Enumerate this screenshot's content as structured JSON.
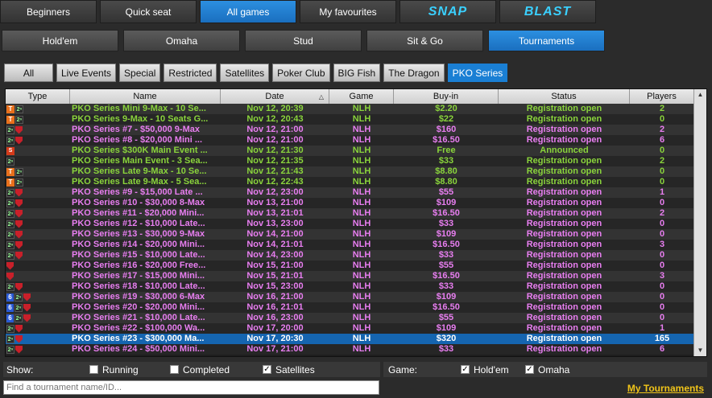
{
  "top_tabs": [
    {
      "label": "Beginners",
      "active": false
    },
    {
      "label": "Quick seat",
      "active": false
    },
    {
      "label": "All games",
      "active": true
    },
    {
      "label": "My favourites",
      "active": false
    },
    {
      "label": "SNAP",
      "active": false,
      "logo": true
    },
    {
      "label": "BLAST",
      "active": false,
      "logo": true
    }
  ],
  "sub_tabs": [
    {
      "label": "Hold'em",
      "active": false
    },
    {
      "label": "Omaha",
      "active": false
    },
    {
      "label": "Stud",
      "active": false
    },
    {
      "label": "Sit & Go",
      "active": false
    },
    {
      "label": "Tournaments",
      "active": true
    }
  ],
  "filters": [
    {
      "label": "All",
      "active": false
    },
    {
      "label": "Live Events",
      "active": false
    },
    {
      "label": "Special",
      "active": false
    },
    {
      "label": "Restricted",
      "active": false
    },
    {
      "label": "Satellites",
      "active": false
    },
    {
      "label": "Poker Club",
      "active": false
    },
    {
      "label": "BIG Fish",
      "active": false
    },
    {
      "label": "The Dragon",
      "active": false
    },
    {
      "label": "PKO Series",
      "active": true
    }
  ],
  "columns": {
    "type": "Type",
    "name": "Name",
    "date": "Date",
    "game": "Game",
    "buyin": "Buy-in",
    "status": "Status",
    "players": "Players"
  },
  "rows": [
    {
      "icons": [
        "T",
        "2"
      ],
      "name": "PKO Series Mini 9-Max - 10 Se...",
      "date": "Nov 12, 20:39",
      "game": "NLH",
      "buyin": "$2.20",
      "status": "Registration open",
      "players": "2",
      "color": "green"
    },
    {
      "icons": [
        "T",
        "2"
      ],
      "name": "PKO Series 9-Max - 10 Seats G...",
      "date": "Nov 12, 20:43",
      "game": "NLH",
      "buyin": "$22",
      "status": "Registration open",
      "players": "0",
      "color": "green"
    },
    {
      "icons": [
        "2",
        "sh"
      ],
      "name": "PKO Series #7 - $50,000 9-Max",
      "date": "Nov 12, 21:00",
      "game": "NLH",
      "buyin": "$160",
      "status": "Registration open",
      "players": "2",
      "color": "pink"
    },
    {
      "icons": [
        "2",
        "sh"
      ],
      "name": "PKO Series #8 - $20,000 Mini ...",
      "date": "Nov 12, 21:00",
      "game": "NLH",
      "buyin": "$16.50",
      "status": "Registration open",
      "players": "6",
      "color": "pink"
    },
    {
      "icons": [
        "si"
      ],
      "name": "PKO Series $300K Main Event ...",
      "date": "Nov 12, 21:30",
      "game": "NLH",
      "buyin": "Free",
      "status": "Announced",
      "players": "0",
      "color": "green"
    },
    {
      "icons": [
        "2"
      ],
      "name": "PKO Series Main Event - 3 Sea...",
      "date": "Nov 12, 21:35",
      "game": "NLH",
      "buyin": "$33",
      "status": "Registration open",
      "players": "2",
      "color": "green"
    },
    {
      "icons": [
        "T",
        "2"
      ],
      "name": "PKO Series Late 9-Max - 10 Se...",
      "date": "Nov 12, 21:43",
      "game": "NLH",
      "buyin": "$8.80",
      "status": "Registration open",
      "players": "0",
      "color": "green"
    },
    {
      "icons": [
        "T",
        "2"
      ],
      "name": "PKO Series Late 9-Max - 5 Sea...",
      "date": "Nov 12, 22:43",
      "game": "NLH",
      "buyin": "$8.80",
      "status": "Registration open",
      "players": "0",
      "color": "green"
    },
    {
      "icons": [
        "2",
        "sh"
      ],
      "name": "PKO Series #9 - $15,000 Late ...",
      "date": "Nov 12, 23:00",
      "game": "NLH",
      "buyin": "$55",
      "status": "Registration open",
      "players": "1",
      "color": "pink"
    },
    {
      "icons": [
        "2",
        "sh"
      ],
      "name": "PKO Series #10 - $30,000 8-Max",
      "date": "Nov 13, 21:00",
      "game": "NLH",
      "buyin": "$109",
      "status": "Registration open",
      "players": "0",
      "color": "pink"
    },
    {
      "icons": [
        "2",
        "sh"
      ],
      "name": "PKO Series #11 - $20,000 Mini...",
      "date": "Nov 13, 21:01",
      "game": "NLH",
      "buyin": "$16.50",
      "status": "Registration open",
      "players": "2",
      "color": "pink"
    },
    {
      "icons": [
        "2",
        "sh"
      ],
      "name": "PKO Series #12 - $10,000 Late...",
      "date": "Nov 13, 23:00",
      "game": "NLH",
      "buyin": "$33",
      "status": "Registration open",
      "players": "0",
      "color": "pink"
    },
    {
      "icons": [
        "2",
        "sh"
      ],
      "name": "PKO Series #13 - $30,000 9-Max",
      "date": "Nov 14, 21:00",
      "game": "NLH",
      "buyin": "$109",
      "status": "Registration open",
      "players": "0",
      "color": "pink"
    },
    {
      "icons": [
        "2",
        "sh"
      ],
      "name": "PKO Series #14 - $20,000 Mini...",
      "date": "Nov 14, 21:01",
      "game": "NLH",
      "buyin": "$16.50",
      "status": "Registration open",
      "players": "3",
      "color": "pink"
    },
    {
      "icons": [
        "2",
        "sh"
      ],
      "name": "PKO Series #15 - $10,000 Late...",
      "date": "Nov 14, 23:00",
      "game": "NLH",
      "buyin": "$33",
      "status": "Registration open",
      "players": "0",
      "color": "pink"
    },
    {
      "icons": [
        "sh"
      ],
      "name": "PKO Series #16 - $20,000 Free...",
      "date": "Nov 15, 21:00",
      "game": "NLH",
      "buyin": "$55",
      "status": "Registration open",
      "players": "0",
      "color": "pink"
    },
    {
      "icons": [
        "sh"
      ],
      "name": "PKO Series #17 - $15,000 Mini...",
      "date": "Nov 15, 21:01",
      "game": "NLH",
      "buyin": "$16.50",
      "status": "Registration open",
      "players": "3",
      "color": "pink"
    },
    {
      "icons": [
        "2",
        "sh"
      ],
      "name": "PKO Series #18 - $10,000 Late...",
      "date": "Nov 15, 23:00",
      "game": "NLH",
      "buyin": "$33",
      "status": "Registration open",
      "players": "0",
      "color": "pink"
    },
    {
      "icons": [
        "6",
        "2",
        "sh"
      ],
      "name": "PKO Series #19 - $30,000 6-Max",
      "date": "Nov 16, 21:00",
      "game": "NLH",
      "buyin": "$109",
      "status": "Registration open",
      "players": "0",
      "color": "pink"
    },
    {
      "icons": [
        "6",
        "2",
        "sh"
      ],
      "name": "PKO Series #20 - $20,000 Mini...",
      "date": "Nov 16, 21:01",
      "game": "NLH",
      "buyin": "$16.50",
      "status": "Registration open",
      "players": "0",
      "color": "pink"
    },
    {
      "icons": [
        "6",
        "2",
        "sh"
      ],
      "name": "PKO Series #21 - $10,000 Late...",
      "date": "Nov 16, 23:00",
      "game": "NLH",
      "buyin": "$55",
      "status": "Registration open",
      "players": "0",
      "color": "pink"
    },
    {
      "icons": [
        "2",
        "sh"
      ],
      "name": "PKO Series #22 - $100,000 Wa...",
      "date": "Nov 17, 20:00",
      "game": "NLH",
      "buyin": "$109",
      "status": "Registration open",
      "players": "1",
      "color": "pink"
    },
    {
      "icons": [
        "2",
        "sh"
      ],
      "name": "PKO Series #23 - $300,000 Ma...",
      "date": "Nov 17, 20:30",
      "game": "NLH",
      "buyin": "$320",
      "status": "Registration open",
      "players": "165",
      "color": "pink",
      "selected": true
    },
    {
      "icons": [
        "2",
        "sh"
      ],
      "name": "PKO Series #24 - $50,000 Mini...",
      "date": "Nov 17, 21:00",
      "game": "NLH",
      "buyin": "$33",
      "status": "Registration open",
      "players": "6",
      "color": "pink"
    }
  ],
  "icon_glyphs": {
    "T": "T",
    "si": "S",
    "2": "2ⁿ",
    "6": "6",
    "sh": ""
  },
  "show": {
    "label": "Show:",
    "options": [
      {
        "label": "Running",
        "checked": false
      },
      {
        "label": "Completed",
        "checked": false
      },
      {
        "label": "Satellites",
        "checked": true
      }
    ]
  },
  "game": {
    "label": "Game:",
    "options": [
      {
        "label": "Hold'em",
        "checked": true
      },
      {
        "label": "Omaha",
        "checked": true
      }
    ]
  },
  "search": {
    "placeholder": "Find a tournament name/ID..."
  },
  "my_tournaments": "My Tournaments",
  "colors": {
    "pink": "#e87ef0",
    "green": "#8ad43c",
    "accent": "#1a7fd4"
  }
}
